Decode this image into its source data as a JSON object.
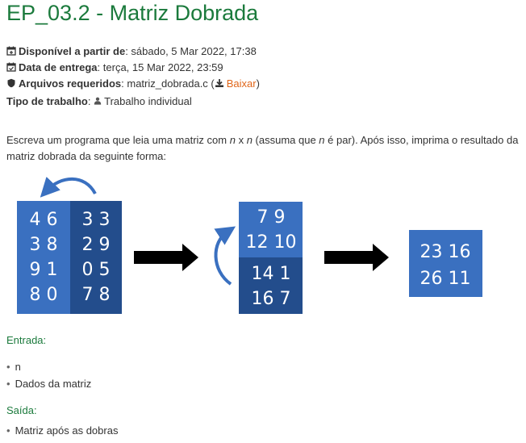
{
  "title": "EP_03.2 - Matriz Dobrada",
  "meta": {
    "available_label": "Disponível a partir de",
    "available_value": ": sábado, 5 Mar 2022, 17:38",
    "due_label": "Data de entrega",
    "due_value": ": terça, 15 Mar 2022, 23:59",
    "files_label": "Arquivos requeridos",
    "files_value": ": matriz_dobrada.c (",
    "download_label": "Baixar",
    "files_close": ")",
    "type_label": "Tipo de trabalho",
    "type_value": "Trabalho individual"
  },
  "description": {
    "part1": "Escreva um programa que leia uma matriz com ",
    "n1": "n",
    "x": " x ",
    "n2": "n",
    "part2": " (assuma que ",
    "n3": "n",
    "part3": " é par). Após isso, imprima o resultado da matriz dobrada da seguinte forma:"
  },
  "figure": {
    "matrix1_left": [
      "4 6",
      "3 8",
      "9 1",
      "8 0"
    ],
    "matrix1_right": [
      "3 3",
      "2 9",
      "0 5",
      "7 8"
    ],
    "matrix2_top": [
      "7 9",
      "12 10"
    ],
    "matrix2_bottom": [
      "14 1",
      "16 7"
    ],
    "matrix3": [
      "23 16",
      "26 11"
    ],
    "colors": {
      "light": "#3a70c0",
      "dark": "#234d8c",
      "arrow": "#3a70c0"
    }
  },
  "input_section": {
    "heading": "Entrada:",
    "items": [
      "n",
      "Dados da matriz"
    ]
  },
  "output_section": {
    "heading": "Saída:",
    "items": [
      "Matriz após as dobras"
    ]
  }
}
